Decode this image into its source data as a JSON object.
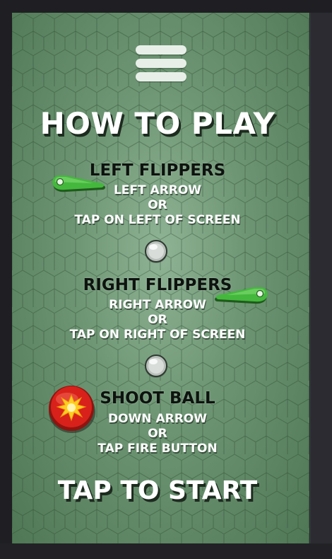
{
  "screen": {
    "title": "HOW TO PLAY",
    "menu_icon": "hamburger-menu-icon"
  },
  "instructions": {
    "left": {
      "heading": "LEFT FLIPPERS",
      "line1": "LEFT ARROW",
      "line2": "OR",
      "line3": "TAP ON LEFT OF SCREEN",
      "icon": "left-flipper-icon"
    },
    "right": {
      "heading": "RIGHT FLIPPERS",
      "line1": "RIGHT ARROW",
      "line2": "OR",
      "line3": "TAP ON RIGHT OF SCREEN",
      "icon": "right-flipper-icon"
    },
    "shoot": {
      "heading": "SHOOT BALL",
      "line1": "DOWN ARROW",
      "line2": "OR",
      "line3": "TAP FIRE BUTTON",
      "icon": "fire-button-icon"
    }
  },
  "start_label": "TAP TO START",
  "colors": {
    "background": "#6e9674",
    "flipper": "#3fb43a",
    "fire_button": "#d8211a",
    "title_text": "#ffffff",
    "heading_text": "#0e130f"
  }
}
